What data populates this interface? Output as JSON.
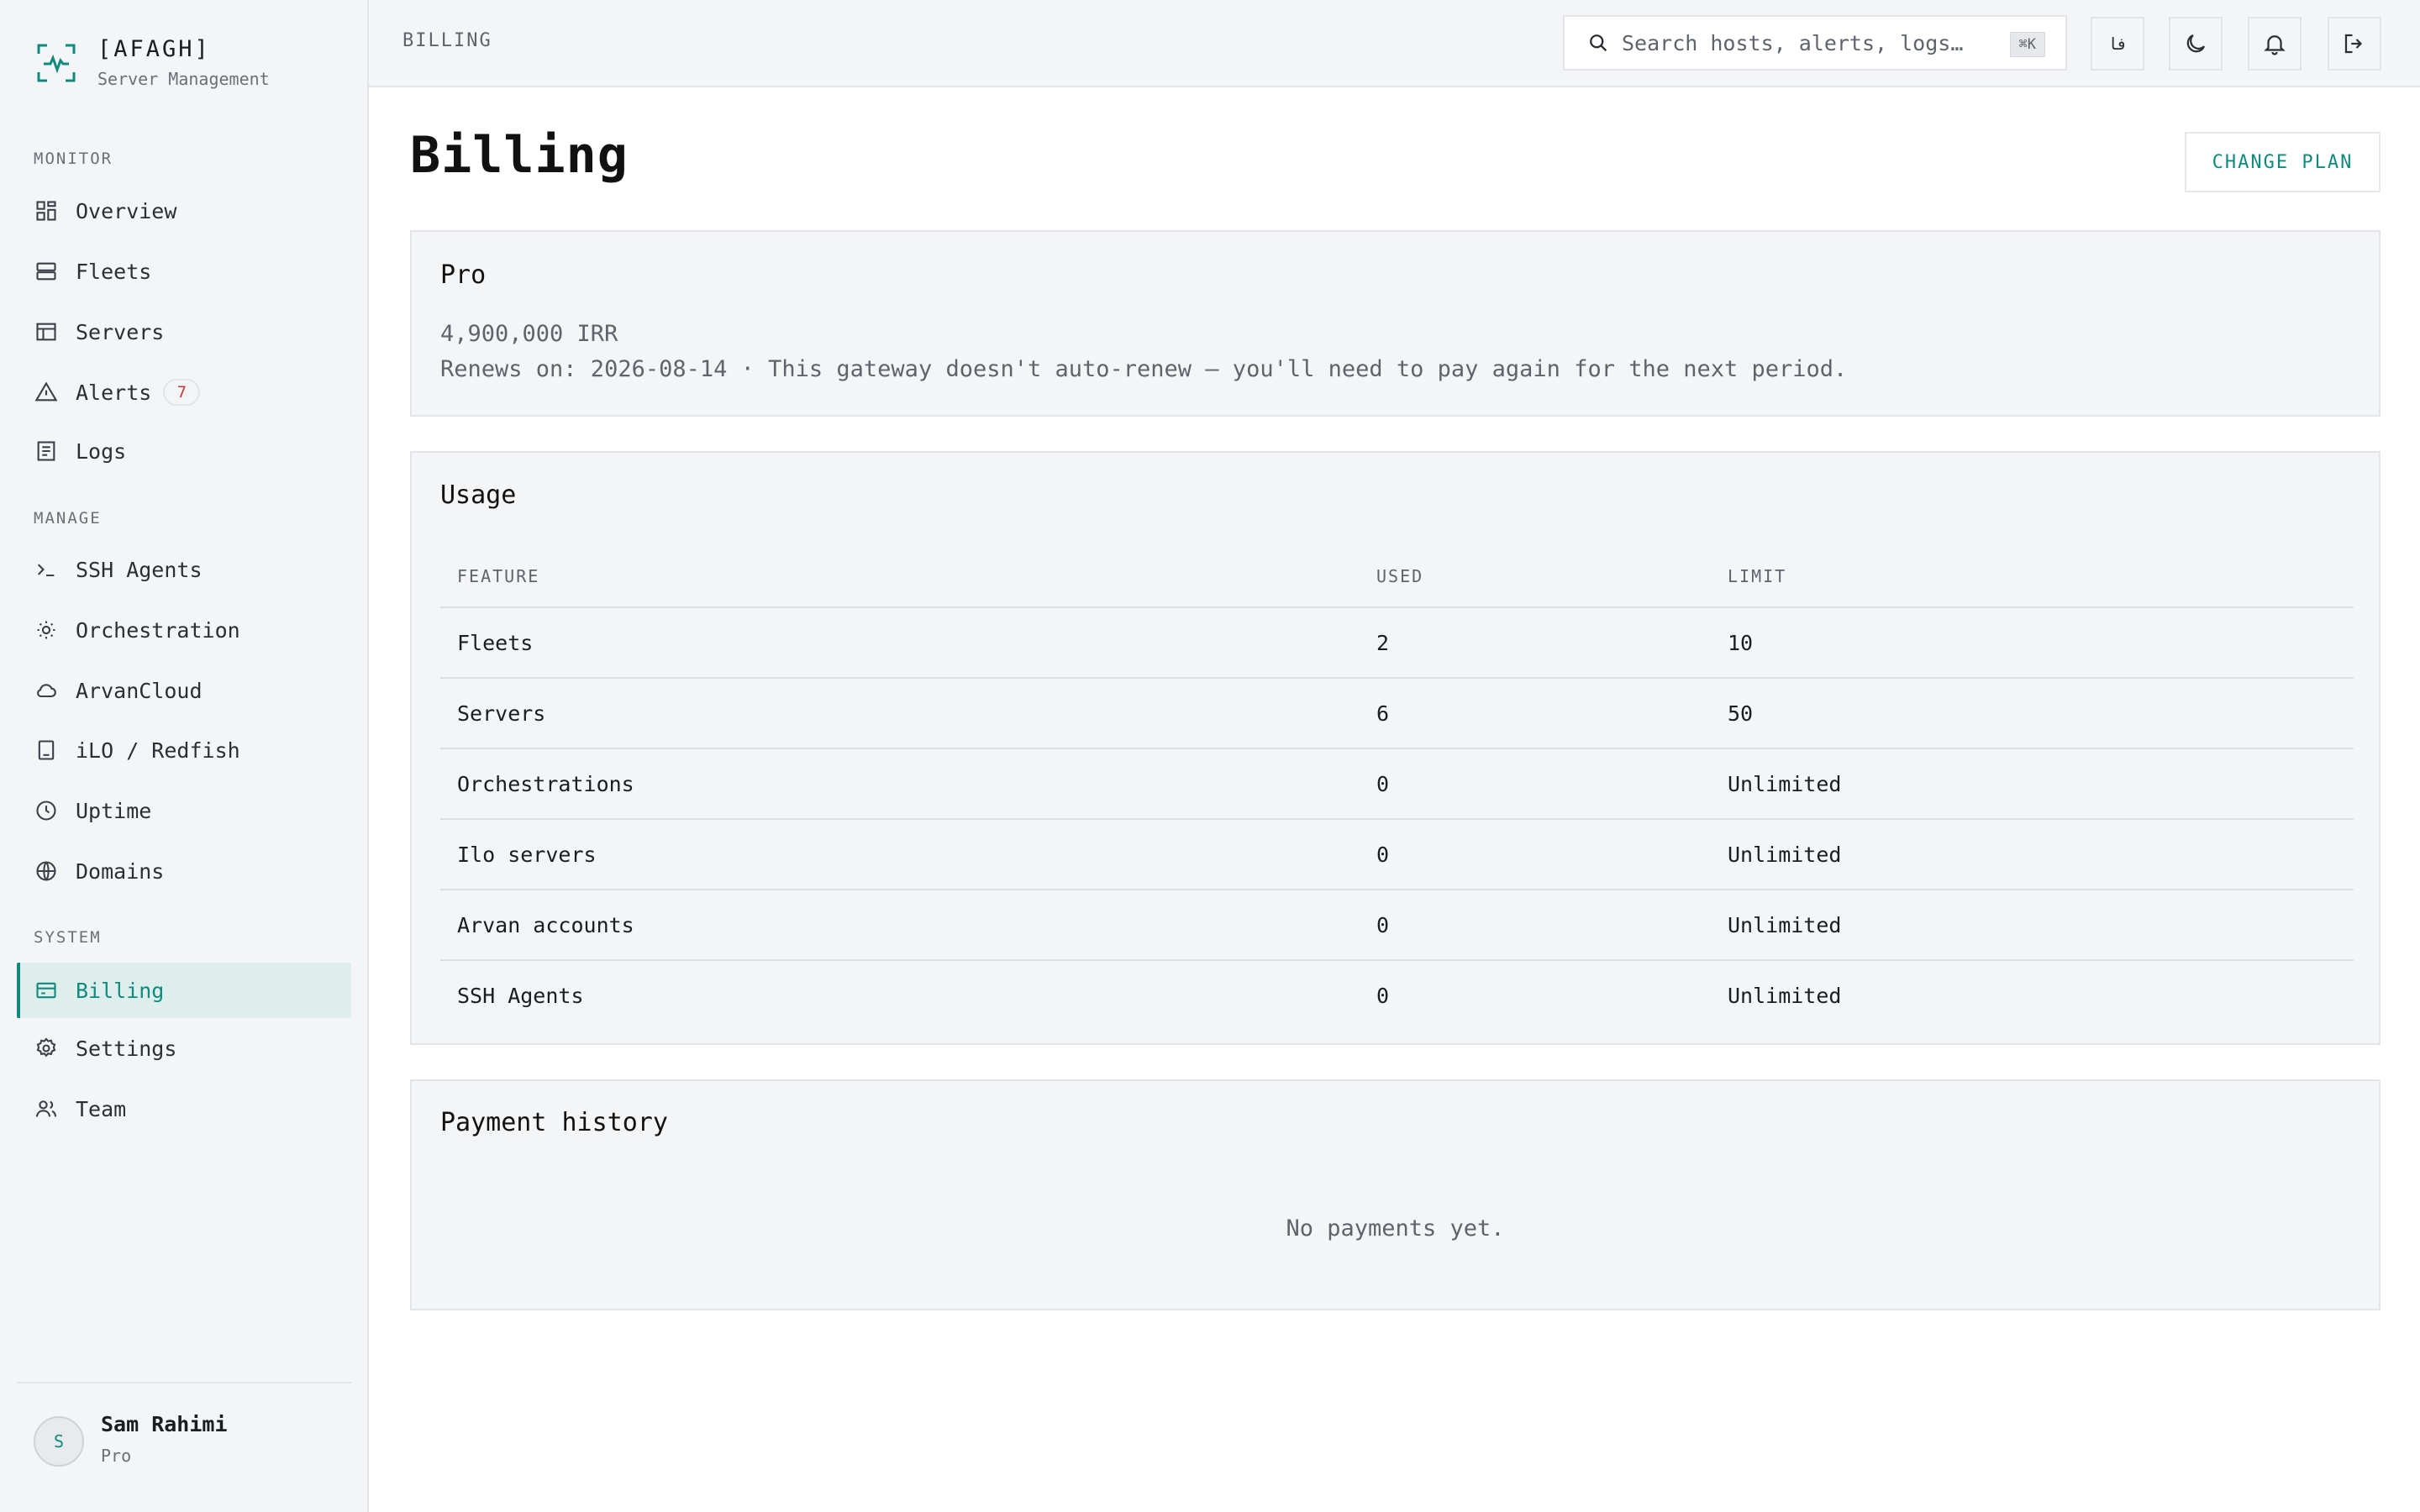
{
  "brand": {
    "name": "[AFAGH]",
    "subtitle": "Server Management"
  },
  "sidebar": {
    "sections": [
      {
        "label": "MONITOR"
      },
      {
        "label": "MANAGE"
      },
      {
        "label": "SYSTEM"
      }
    ],
    "items": [
      {
        "label": "Overview",
        "icon": "grid-icon"
      },
      {
        "label": "Fleets",
        "icon": "server-stack-icon"
      },
      {
        "label": "Servers",
        "icon": "table-icon"
      },
      {
        "label": "Alerts",
        "icon": "alert-triangle-icon",
        "badge": "7"
      },
      {
        "label": "Logs",
        "icon": "document-icon"
      },
      {
        "label": "SSH Agents",
        "icon": "terminal-icon"
      },
      {
        "label": "Orchestration",
        "icon": "sun-cog-icon"
      },
      {
        "label": "ArvanCloud",
        "icon": "cloud-icon"
      },
      {
        "label": "iLO / Redfish",
        "icon": "device-icon"
      },
      {
        "label": "Uptime",
        "icon": "clock-icon"
      },
      {
        "label": "Domains",
        "icon": "globe-icon"
      },
      {
        "label": "Billing",
        "icon": "credit-card-icon",
        "active": true
      },
      {
        "label": "Settings",
        "icon": "gear-icon"
      },
      {
        "label": "Team",
        "icon": "users-icon"
      }
    ]
  },
  "user": {
    "initial": "S",
    "name": "Sam Rahimi",
    "plan": "Pro"
  },
  "topbar": {
    "breadcrumb": "BILLING",
    "search_placeholder": "Search hosts, alerts, logs…",
    "search_shortcut": "⌘K",
    "language_label": "فا"
  },
  "page": {
    "title": "Billing",
    "change_plan_label": "CHANGE PLAN"
  },
  "plan": {
    "name": "Pro",
    "price": "4,900,000 IRR",
    "renewal": "Renews on: 2026-08-14 · This gateway doesn't auto-renew — you'll need to pay again for the next period."
  },
  "usage": {
    "title": "Usage",
    "columns": [
      "FEATURE",
      "USED",
      "LIMIT"
    ],
    "rows": [
      [
        "Fleets",
        "2",
        "10"
      ],
      [
        "Servers",
        "6",
        "50"
      ],
      [
        "Orchestrations",
        "0",
        "Unlimited"
      ],
      [
        "Ilo servers",
        "0",
        "Unlimited"
      ],
      [
        "Arvan accounts",
        "0",
        "Unlimited"
      ],
      [
        "SSH Agents",
        "0",
        "Unlimited"
      ]
    ]
  },
  "payments": {
    "title": "Payment history",
    "empty_text": "No payments yet."
  },
  "colors": {
    "accent": "#0f8a7c",
    "alert": "#c93a3a",
    "panel": "#f4f5f7",
    "border": "#e2e4e8"
  }
}
